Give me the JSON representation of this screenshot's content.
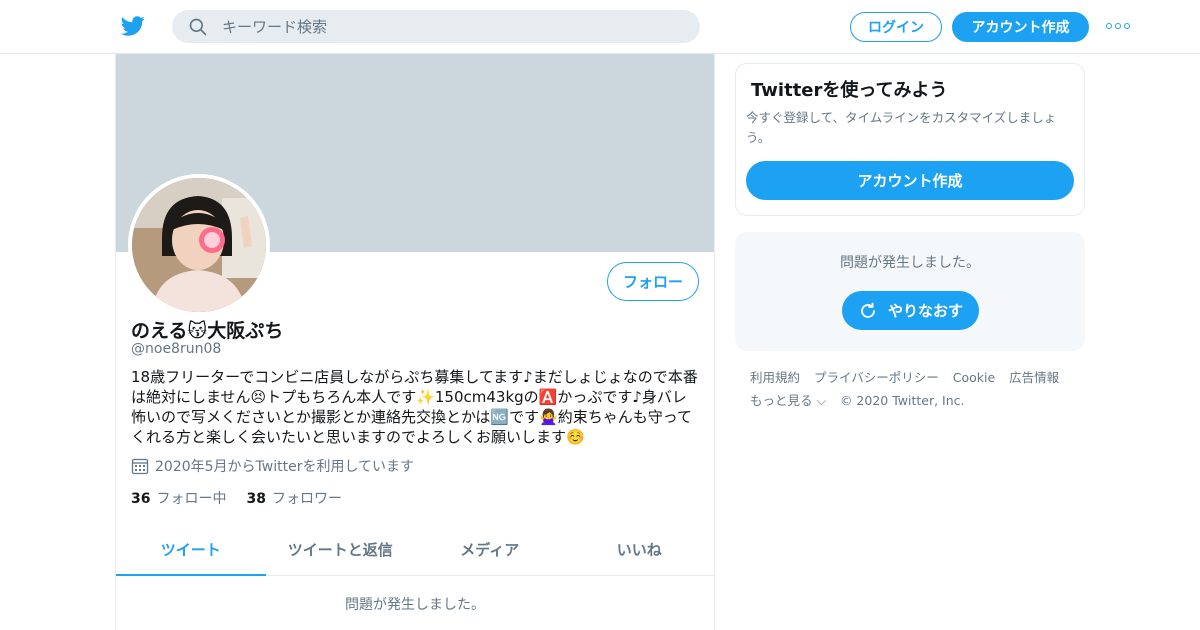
{
  "header": {
    "search_placeholder": "キーワード検索",
    "login_label": "ログイン",
    "signup_label": "アカウント作成"
  },
  "profile": {
    "follow_label": "フォロー",
    "display_name": "のえる😽大阪ぷち",
    "handle": "@noe8run08",
    "bio": "18歳フリーターでコンビニ店員しながらぷち募集してます♪まだしょじょなので本番は絶対にしません😣トプもちろん本人です✨150cm43kgの🅰️かっぷです♪身バレ怖いので写メくださいとか撮影とか連絡先交換とかは🆖です🙅‍♀️約束ちゃんも守ってくれる方と楽しく会いたいと思いますのでよろしくお願いします☺️",
    "joined": "2020年5月からTwitterを利用しています",
    "following_count": "36",
    "following_label": "フォロー中",
    "followers_count": "38",
    "followers_label": "フォロワー"
  },
  "tabs": [
    {
      "label": "ツイート",
      "active": true
    },
    {
      "label": "ツイートと返信",
      "active": false
    },
    {
      "label": "メディア",
      "active": false
    },
    {
      "label": "いいね",
      "active": false
    }
  ],
  "main_error": "問題が発生しました。",
  "signup_card": {
    "title": "Twitterを使ってみよう",
    "description": "今すぐ登録して、タイムラインをカスタマイズしましょう。",
    "button_label": "アカウント作成"
  },
  "error_card": {
    "message": "問題が発生しました。",
    "retry_label": "やりなおす"
  },
  "footer": {
    "links": [
      "利用規約",
      "プライバシーポリシー",
      "Cookie",
      "広告情報",
      "もっと見る ⌵"
    ],
    "copyright": "© 2020 Twitter, Inc."
  },
  "colors": {
    "accent": "#1da1f2",
    "secondary_text": "#657786",
    "banner": "#ccd6dd"
  }
}
